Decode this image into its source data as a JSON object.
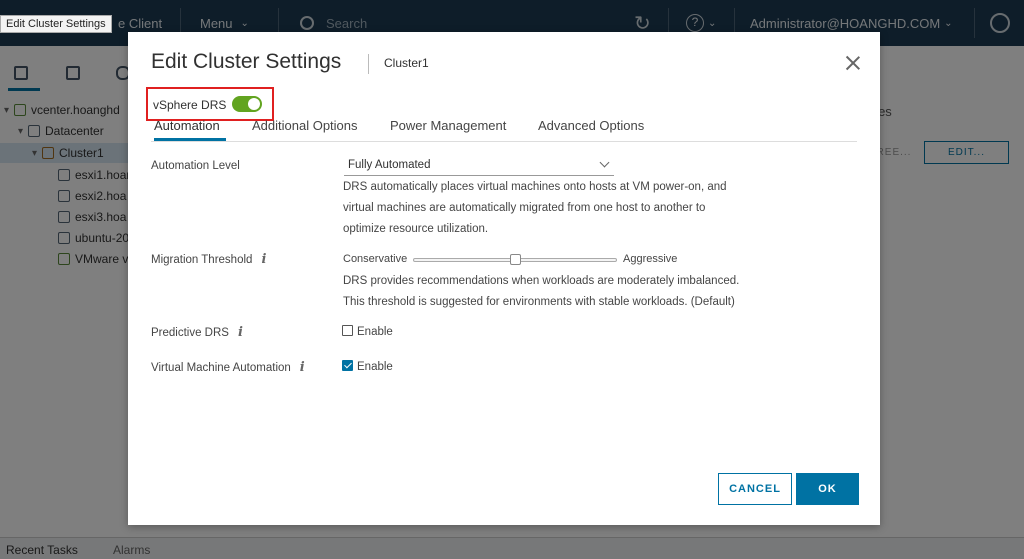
{
  "tooltip": "Edit Cluster Settings",
  "topbar": {
    "app_title_fragment": "e Client",
    "menu_label": "Menu",
    "search_placeholder": "Search",
    "user_label": "Administrator@HOANGHD.COM"
  },
  "tree": {
    "items": [
      {
        "label": "vcenter.hoanghd"
      },
      {
        "label": "Datacenter"
      },
      {
        "label": "Cluster1"
      },
      {
        "label": "esxi1.hoan"
      },
      {
        "label": "esxi2.hoa"
      },
      {
        "label": "esxi3.hoa"
      },
      {
        "label": "ubuntu-20"
      },
      {
        "label": "VMware v"
      }
    ]
  },
  "right_panel": {
    "tab_fragment": "dates",
    "btn_fragment": "REE...",
    "edit_button": "EDIT..."
  },
  "bottom_bar": {
    "recent_tasks": "Recent Tasks",
    "alarms": "Alarms"
  },
  "dialog": {
    "title": "Edit Cluster Settings",
    "subtitle": "Cluster1",
    "drs_label": "vSphere DRS",
    "drs_enabled": true,
    "tabs": [
      "Automation",
      "Additional Options",
      "Power Management",
      "Advanced Options"
    ],
    "active_tab": "Automation",
    "automation_level": {
      "label": "Automation Level",
      "value": "Fully Automated",
      "description": [
        "DRS automatically places virtual machines onto hosts at VM power-on, and",
        "virtual machines are automatically migrated from one host to another to",
        "optimize resource utilization."
      ]
    },
    "migration_threshold": {
      "label": "Migration Threshold",
      "min_label": "Conservative",
      "max_label": "Aggressive",
      "level": 3,
      "level_count": 5,
      "description": [
        "DRS provides recommendations when workloads are moderately imbalanced.",
        "This threshold is suggested for environments with stable workloads. (Default)"
      ]
    },
    "predictive_drs": {
      "label": "Predictive DRS",
      "checkbox_label": "Enable",
      "checked": false
    },
    "vm_automation": {
      "label": "Virtual Machine Automation",
      "checkbox_label": "Enable",
      "checked": true
    },
    "cancel_label": "CANCEL",
    "ok_label": "OK"
  },
  "colors": {
    "accent": "#0072a3",
    "toggle_on": "#62a420",
    "highlight_box": "#e02020",
    "topbar": "#1d3a52"
  }
}
